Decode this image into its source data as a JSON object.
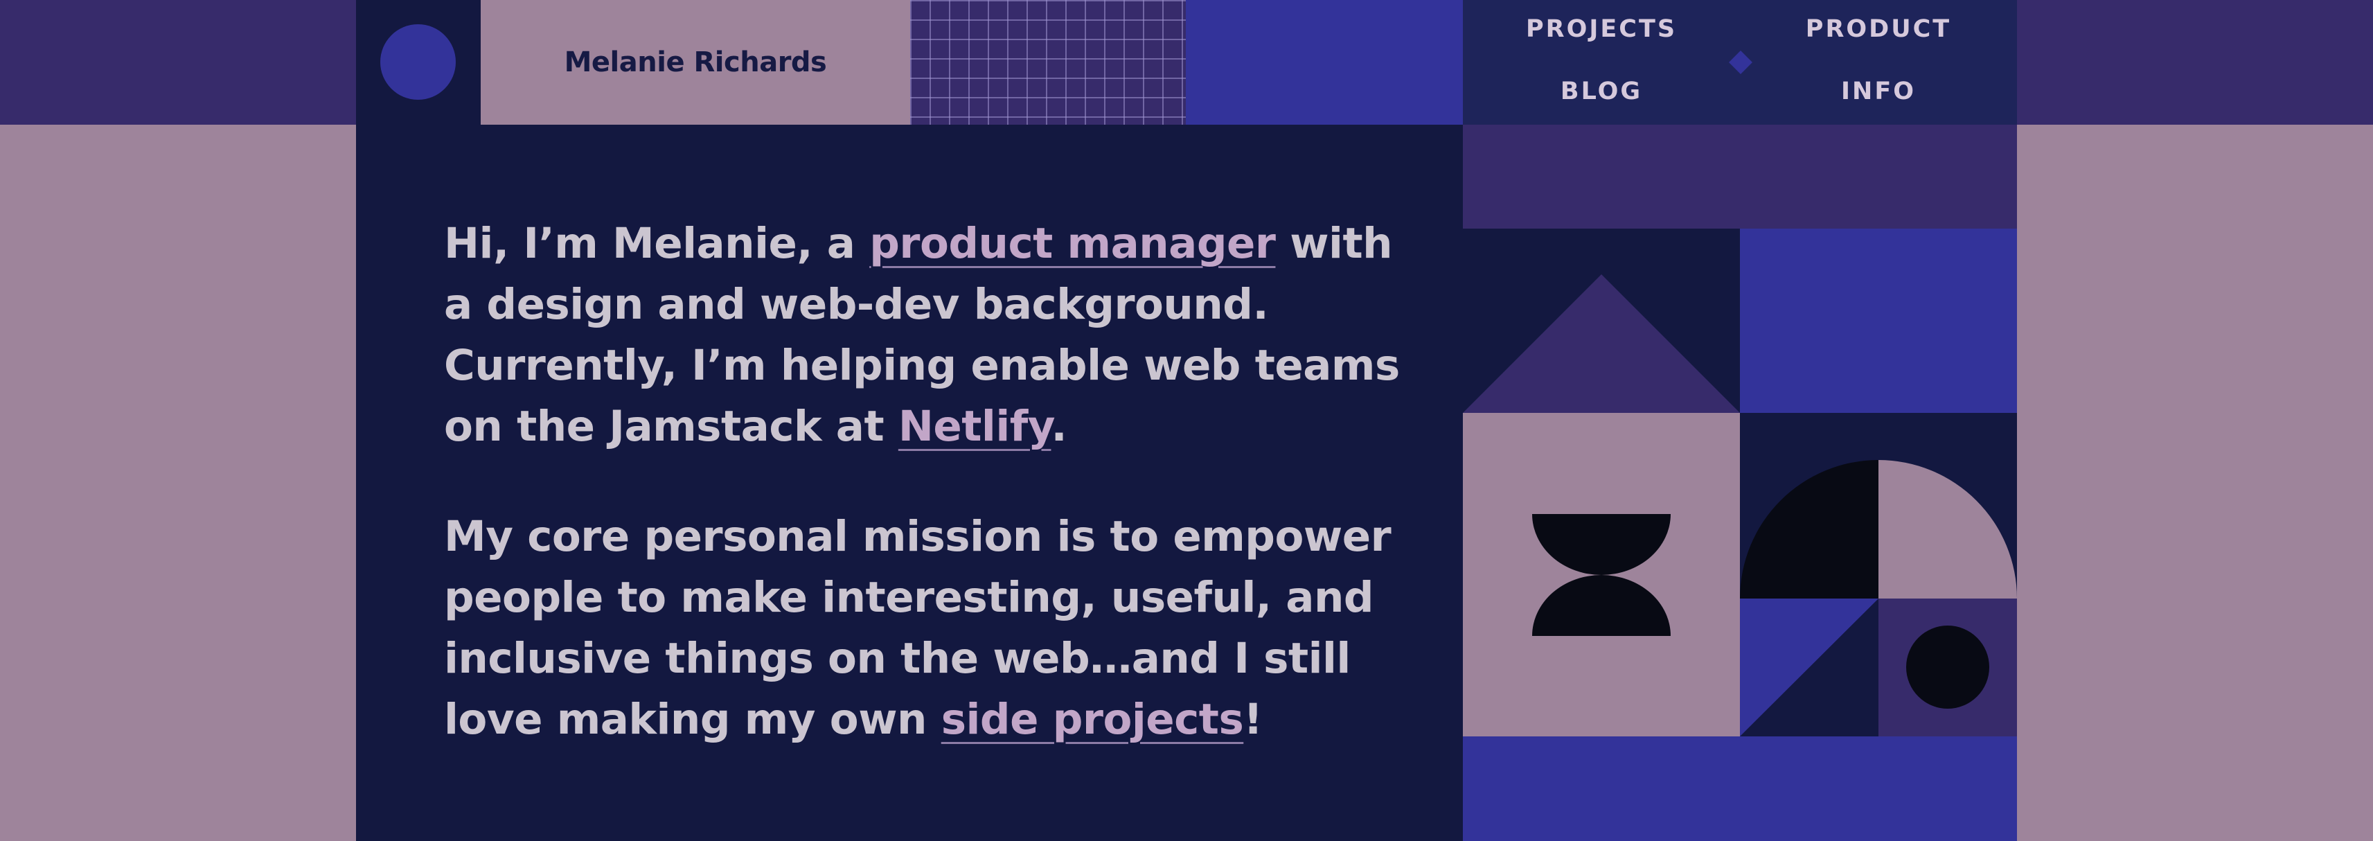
{
  "header": {
    "site_name": "Melanie Richards",
    "nav": {
      "projects": "PROJECTS",
      "product": "PRODUCT",
      "blog": "BLOG",
      "info": "INFO"
    }
  },
  "intro": {
    "part1": "Hi, I’m Melanie, a ",
    "link1": "product manager",
    "part2": " with a design and web-dev background. Currently, I’m helping enable web teams on the Jamstack at ",
    "link2": "Netlify",
    "part3": "."
  },
  "mission": {
    "part1": "My core personal mission is to empower people to make interesting, useful, and inclusive things on the web…and I still love making my own ",
    "link1": "side projects",
    "part2": "!"
  },
  "colors": {
    "navy": "#131840",
    "purple": "#372b6b",
    "blue": "#33339a",
    "mauve": "#9e849b",
    "text": "#cbc5d0",
    "link": "#c2a6c8"
  },
  "icons": {
    "avatar": "circle-avatar",
    "nav_separator": "diamond-icon"
  }
}
